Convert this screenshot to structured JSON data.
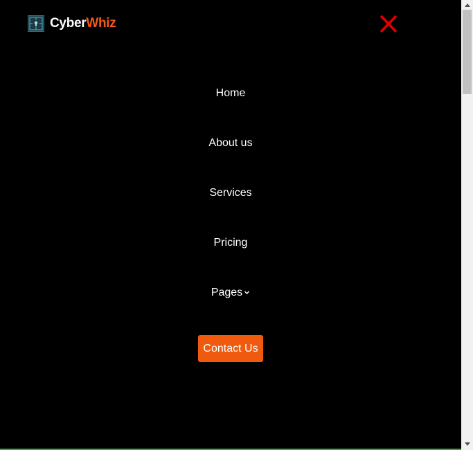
{
  "brand": {
    "name_first": "Cyber",
    "name_second": "Whiz",
    "logo_icon": "security-keyhole-icon"
  },
  "close": {
    "icon": "close-icon",
    "color": "#e00000"
  },
  "nav": {
    "items": [
      {
        "label": "Home"
      },
      {
        "label": "About us"
      },
      {
        "label": "Services"
      },
      {
        "label": "Pricing"
      },
      {
        "label": "Pages",
        "has_dropdown": true
      }
    ],
    "contact_label": "Contact Us"
  },
  "colors": {
    "accent": "#f05a0e",
    "background": "#000000",
    "text": "#ffffff"
  }
}
